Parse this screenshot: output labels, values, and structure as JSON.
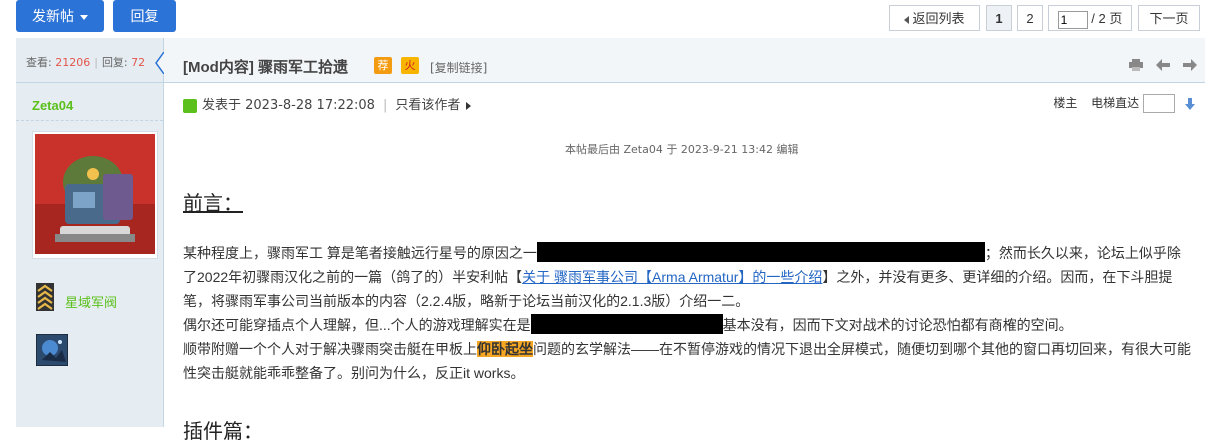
{
  "toolbar": {
    "new_post": "发新帖",
    "reply": "回复",
    "back_to_list": "返回列表",
    "pages": [
      "1",
      "2"
    ],
    "current_page": "1",
    "total_pages": "/ 2 页",
    "next": "下一页"
  },
  "sidebar": {
    "views_label": "查看:",
    "views": "21206",
    "replies_label": "回复:",
    "replies": "72",
    "author": "Zeta04",
    "rank": "星域军阀"
  },
  "post": {
    "title": "[Mod内容] 骤雨军工拾遗",
    "badge_recommend": "荐",
    "badge_hot": "火",
    "copy_link": "[复制链接]",
    "posted_at": "发表于 2023-8-28 17:22:08",
    "only_author": "只看该作者",
    "floor_label": "楼主",
    "elevator_label": "电梯直达",
    "edit_note": "本帖最后由 Zeta04 于 2023-9-21 13:42 编辑",
    "heading_preface": "前言：",
    "p1_a": "某种程度上，骤雨军工 算是笔者接触远行星号的原因之一",
    "p1_b": "；然而长久以来，论坛上似乎除了2022年初骤雨汉化之前的一篇（鸽了的）半安利帖【",
    "p1_link": "关于 骤雨军事公司【Arma Armatur】的一些介绍",
    "p1_c": "】之外，并没有更多、更详细的介绍。因而，在下斗胆提笔，将骤雨军事公司当前版本的内容（2.2.4版，略新于论坛当前汉化的2.1.3版）介绍一二。",
    "p2_a": "偶尔还可能穿插点个人理解，但...个人的游戏理解实在是",
    "p2_b": "基本没有，因而下文对战术的讨论恐怕都有商榷的空间。",
    "p3_a": "顺带附赠一个个人对于解决骤雨突击艇在甲板上",
    "p3_hl": "仰卧起坐",
    "p3_b": "问题的玄学解法——在不暂停游戏的情况下退出全屏模式，随便切到哪个其他的窗口再切回来，有很大可能性突击艇就能乖乖整备了。别问为什么，反正it works。",
    "heading_plugins": "插件篇："
  },
  "colors": {
    "accent": "#2b73d6",
    "author_green": "#5bc01b",
    "highlight": "#f5a623",
    "link": "#2366c4"
  }
}
